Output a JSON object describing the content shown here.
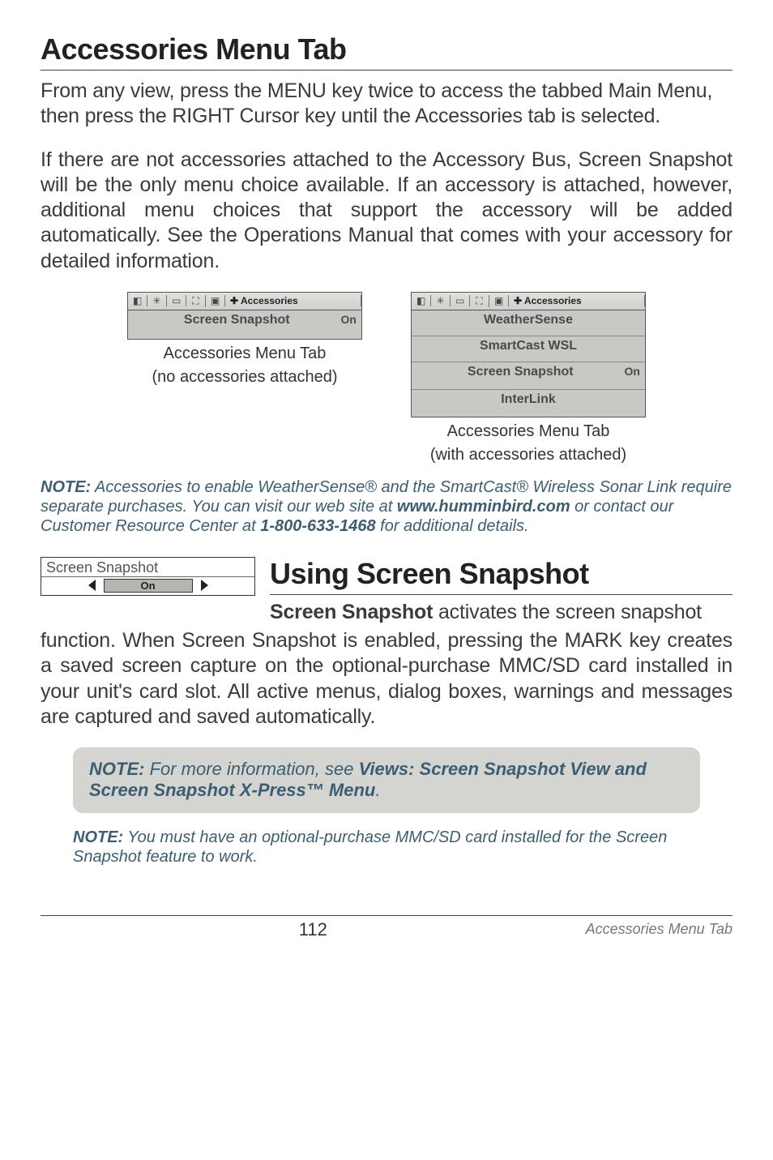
{
  "section1": {
    "title": "Accessories Menu Tab",
    "para1": "From any view, press the MENU key twice to access the tabbed Main Menu, then press the RIGHT Cursor key until the Accessories tab is selected.",
    "para2": "If there are not accessories attached to the Accessory Bus, Screen Snapshot will be the only menu choice available. If an accessory is attached, however, additional menu choices that support the accessory will be added automatically. See the Operations Manual that comes with your accessory for detailed information."
  },
  "acc_menu_left": {
    "tab_label": "Accessories",
    "row1": "Screen Snapshot",
    "row1_val": "On",
    "caption1": "Accessories Menu Tab",
    "caption2": "(no accessories attached)"
  },
  "acc_menu_right": {
    "tab_label": "Accessories",
    "r1": "WeatherSense",
    "r2": "SmartCast WSL",
    "r3": "Screen Snapshot",
    "r3_val": "On",
    "r4": "InterLink",
    "caption1": "Accessories Menu Tab",
    "caption2": "(with accessories attached)"
  },
  "note1": {
    "lead": "NOTE:",
    "pre": " Accessories to enable WeatherSense® and the SmartCast® Wireless Sonar Link require separate purchases. You can visit our web site at ",
    "kw1": "www.humminbird.com",
    "mid": " or contact our Customer Resource Center at ",
    "kw2": "1-800-633-1468",
    "post": " for additional details."
  },
  "widget": {
    "title": "Screen Snapshot",
    "value": "On"
  },
  "section2": {
    "title": "Using Screen Snapshot",
    "lead": "Screen Snapshot",
    "rest_first": " activates the screen snapshot",
    "rest": "function. When Screen Snapshot is enabled, pressing the MARK key creates a saved screen capture on the optional-purchase MMC/SD card installed in your unit's card slot. All active menus, dialog boxes, warnings and messages are captured and saved automatically."
  },
  "callout1": {
    "lead": "NOTE:",
    "pre": " For more information, see ",
    "kw": "Views: Screen Snapshot View and Screen Snapshot X-Press™ Menu",
    "post": "."
  },
  "note2": {
    "lead": "NOTE:",
    "text": " You must have an optional-purchase MMC/SD card installed for the Screen Snapshot feature to work."
  },
  "footer": {
    "page": "112",
    "title": "Accessories Menu Tab"
  }
}
